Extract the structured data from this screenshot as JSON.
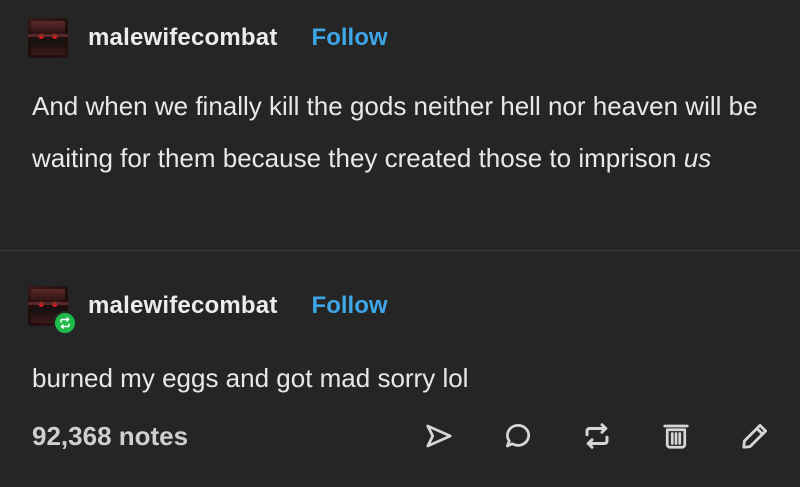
{
  "posts": [
    {
      "username": "malewifecombat",
      "follow_label": "Follow",
      "text_plain": "And when we finally kill the gods neither hell nor heaven will be waiting for them because they created those to imprison ",
      "text_emphasis": "us"
    },
    {
      "username": "malewifecombat",
      "follow_label": "Follow",
      "text": "burned my eggs and got mad sorry lol",
      "reblog_badge_icon": "reblog-icon"
    }
  ],
  "footer": {
    "notes": "92,368 notes",
    "actions": [
      "share-icon",
      "reply-icon",
      "reblog-icon",
      "delete-icon",
      "edit-icon"
    ]
  },
  "colors": {
    "background": "#252525",
    "text": "#ececec",
    "follow": "#3ea6e6",
    "reblog_badge": "#1fba4a"
  }
}
